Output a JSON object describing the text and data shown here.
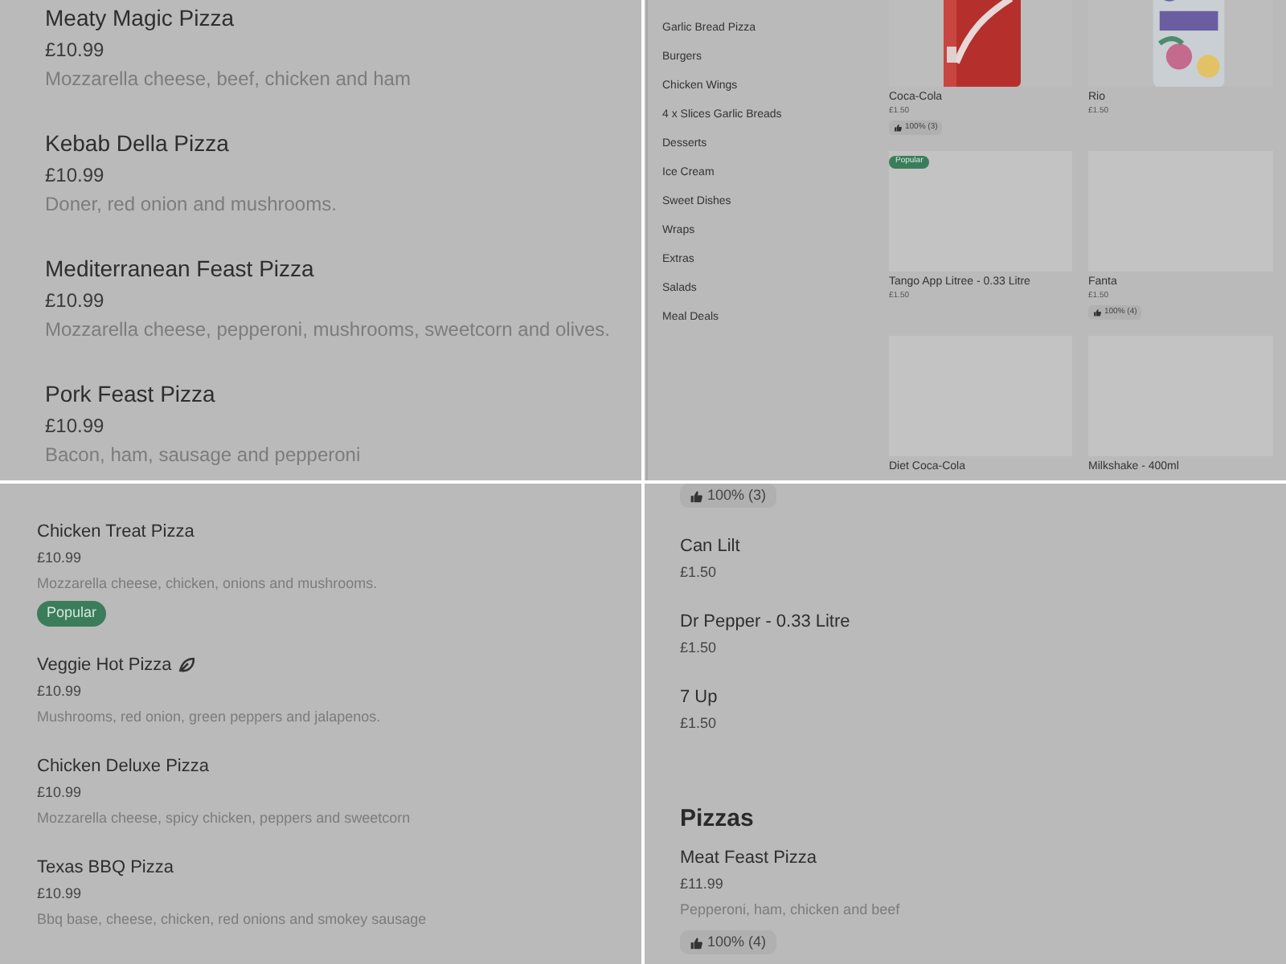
{
  "panels": [
    {
      "kind": "menu_large",
      "entries": [
        {
          "kind": "item",
          "name": "Meaty Magic Pizza",
          "price": "£10.99",
          "description": "Mozzarella cheese, beef, chicken and ham"
        },
        {
          "kind": "item",
          "name": "Kebab Della Pizza",
          "price": "£10.99",
          "description": "Doner, red onion and mushrooms."
        },
        {
          "kind": "item",
          "name": "Mediterranean Feast Pizza",
          "price": "£10.99",
          "description": "Mozzarella cheese, pepperoni, mushrooms, sweetcorn and olives."
        },
        {
          "kind": "item",
          "name": "Pork Feast Pizza",
          "price": "£10.99",
          "description": "Bacon, ham, sausage and pepperoni"
        }
      ]
    },
    {
      "kind": "category_grid",
      "categories": [
        "Garlic Bread Pizza",
        "Burgers",
        "Chicken Wings",
        "4 x Slices Garlic Breads",
        "Desserts",
        "Ice Cream",
        "Sweet Dishes",
        "Wraps",
        "Extras",
        "Salads",
        "Meal Deals"
      ],
      "products": [
        {
          "name": "Coca-Cola",
          "price": "£1.50",
          "rating": "100% (3)",
          "popular": false,
          "kind": "picture"
        },
        {
          "name": "Rio",
          "price": "£1.50",
          "popular": false,
          "kind": "picture"
        },
        {
          "name": "Tango App Litree - 0.33 Litre",
          "price": "£1.50",
          "popular": true,
          "popular_label": "Popular",
          "kind": "blank"
        },
        {
          "name": "Fanta",
          "price": "£1.50",
          "rating": "100% (4)",
          "popular": false,
          "kind": "blank"
        },
        {
          "name": "Diet Coca-Cola",
          "popular": false,
          "kind": "blank"
        },
        {
          "name": "Milkshake - 400ml",
          "popular": false,
          "kind": "blank"
        }
      ]
    },
    {
      "kind": "menu_small",
      "entries": [
        {
          "kind": "item",
          "name": "Chicken Treat Pizza",
          "price": "£10.99",
          "description": "Mozzarella cheese, chicken, onions and mushrooms.",
          "popular": true,
          "popular_label": "Popular",
          "vegetarian": false
        },
        {
          "kind": "item",
          "name": "Veggie Hot Pizza",
          "price": "£10.99",
          "description": "Mushrooms, red onion, green peppers and jalapenos.",
          "popular": false,
          "vegetarian": true
        },
        {
          "kind": "item",
          "name": "Chicken Deluxe Pizza",
          "price": "£10.99",
          "description": "Mozzarella cheese, spicy chicken, peppers and sweetcorn",
          "popular": false,
          "vegetarian": false
        },
        {
          "kind": "item",
          "name": "Texas BBQ Pizza",
          "price": "£10.99",
          "description": "Bbq base, cheese, chicken, red onions and smokey sausage",
          "popular": false,
          "vegetarian": false
        }
      ]
    },
    {
      "kind": "menu_small",
      "entries": [
        {
          "kind": "rating",
          "rating": "100% (3)"
        },
        {
          "kind": "item",
          "name": "Can Lilt",
          "price": "£1.50"
        },
        {
          "kind": "item",
          "name": "Dr Pepper - 0.33 Litre",
          "price": "£1.50"
        },
        {
          "kind": "item",
          "name": "7 Up",
          "price": "£1.50"
        },
        {
          "kind": "heading",
          "title": "Pizzas"
        },
        {
          "kind": "item",
          "name": "Meat Feast Pizza",
          "price": "£11.99",
          "description": "Pepperoni, ham, chicken and beef",
          "rating": "100% (4)"
        }
      ]
    }
  ]
}
